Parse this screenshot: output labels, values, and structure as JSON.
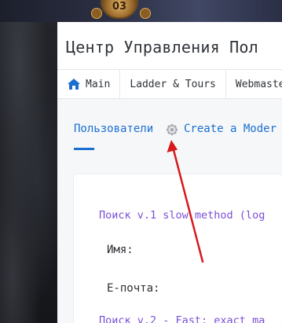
{
  "banner": {
    "badge_text": "03"
  },
  "header": {
    "title": "Центр Управления Пол"
  },
  "nav": {
    "items": [
      {
        "label": "Main",
        "icon": "home-icon"
      },
      {
        "label": "Ladder & Tours"
      },
      {
        "label": "Webmaste"
      }
    ]
  },
  "tabs": {
    "users_label": "Пользователи",
    "gear_icon": "gear-icon",
    "create_label": "Create a Moder"
  },
  "search": {
    "v1_title": "Поиск v.1 slow method (log",
    "name_label": "Имя:",
    "email_label": "E-почта:",
    "v2_title": "Поиск v.2 - Fast; exact ma"
  },
  "colors": {
    "link_blue": "#1a6fd1",
    "section_purple": "#7a4fd6",
    "annotation_red": "#d7191c"
  }
}
